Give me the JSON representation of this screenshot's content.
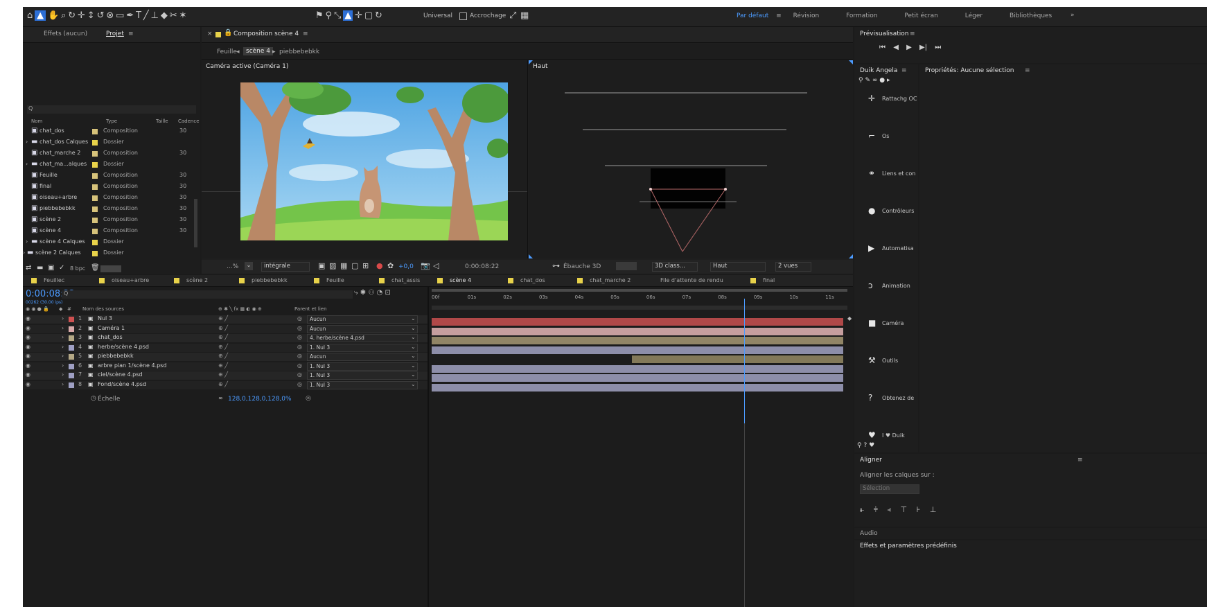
{
  "toolbar": {
    "universal_label": "Universal",
    "snap_label": "Accrochage",
    "workspaces": [
      "Par défaut",
      "Révision",
      "Formation",
      "Petit écran",
      "Léger",
      "Bibliothèques"
    ],
    "more": "»"
  },
  "project_panel": {
    "tabs": [
      "Effets (aucun)",
      "Projet"
    ],
    "search_placeholder": "Q",
    "columns": [
      "Nom",
      "Type",
      "Taille",
      "Cadence"
    ],
    "items": [
      {
        "name": "chat_dos",
        "type": "Composition",
        "extra": "30",
        "color": "#d6c27a",
        "kind": "comp"
      },
      {
        "name": "chat_dos Calques",
        "type": "Dossier",
        "extra": "",
        "color": "#e8d24a",
        "kind": "folder"
      },
      {
        "name": "chat_marche 2",
        "type": "Composition",
        "extra": "30",
        "color": "#d6c27a",
        "kind": "comp"
      },
      {
        "name": "chat_ma...alques",
        "type": "Dossier",
        "extra": "",
        "color": "#e8d24a",
        "kind": "folder"
      },
      {
        "name": "Feuille",
        "type": "Composition",
        "extra": "30",
        "color": "#d6c27a",
        "kind": "comp"
      },
      {
        "name": "final",
        "type": "Composition",
        "extra": "30",
        "color": "#d6c27a",
        "kind": "comp"
      },
      {
        "name": "oiseau+arbre",
        "type": "Composition",
        "extra": "30",
        "color": "#d6c27a",
        "kind": "comp"
      },
      {
        "name": "piebbebebkk",
        "type": "Composition",
        "extra": "30",
        "color": "#d6c27a",
        "kind": "comp"
      },
      {
        "name": "scène 2",
        "type": "Composition",
        "extra": "30",
        "color": "#d6c27a",
        "kind": "comp"
      },
      {
        "name": "scène 4",
        "type": "Composition",
        "extra": "30",
        "color": "#d6c27a",
        "kind": "comp"
      },
      {
        "name": "scène 4 Calques",
        "type": "Dossier",
        "extra": "",
        "color": "#e8d24a",
        "kind": "folder"
      },
      {
        "name": "scène 2 Calques",
        "type": "Dossier",
        "extra": "",
        "color": "#e8d24a",
        "kind": "folder"
      }
    ],
    "bpc": "8 bpc"
  },
  "comp_panel": {
    "title": "Composition scène 4",
    "breadcrumb": [
      "Feuille",
      "scène 4",
      "piebbebebkk"
    ],
    "active_view_label": "Caméra active (Caméra 1)",
    "top_view_label": "Haut",
    "zoom": "...%",
    "quality": "intégrale",
    "timecode": "0:00:08:22",
    "renderer": "Ébauche 3D",
    "view_mode": "3D class...",
    "view_select": "Haut",
    "views": "2 vues",
    "exposure": "+0,0"
  },
  "timeline": {
    "tabs": [
      "Feuillec",
      "oiseau+arbre",
      "scène 2",
      "piebbebebkk",
      "Feuille",
      "chat_assis",
      "scène 4",
      "chat_dos",
      "chat_marche 2",
      "File d'attente de rendu",
      "final"
    ],
    "active_tab_index": 6,
    "timecode": "0:00:08:22",
    "frames": "00262 (30.00 ips)",
    "search_placeholder": "Q",
    "col_source": "Nom des sources",
    "col_parent": "Parent et lien",
    "ruler": [
      "00f",
      "01s",
      "02s",
      "03s",
      "04s",
      "05s",
      "06s",
      "07s",
      "08s",
      "09s",
      "10s",
      "11s"
    ],
    "playhead_seconds": 8.73,
    "duration_seconds": 11.5,
    "layers": [
      {
        "num": "1",
        "name": "Nul 3",
        "parent": "Aucun",
        "color": "#cf5151",
        "bar": "#b04848",
        "start": 0,
        "end": 11.5
      },
      {
        "num": "2",
        "name": "Caméra 1",
        "parent": "Aucun",
        "color": "#d8a9a9",
        "bar": "#c69e9e",
        "start": 0,
        "end": 11.5
      },
      {
        "num": "3",
        "name": "chat_dos",
        "parent": "4. herbe/scène 4.psd",
        "color": "#b5a986",
        "bar": "#918566",
        "start": 0,
        "end": 11.5
      },
      {
        "num": "4",
        "name": "herbe/scène 4.psd",
        "parent": "1. Nul 3",
        "color": "#9fa0c4",
        "bar": "#8d8ea9",
        "start": 0,
        "end": 11.5
      },
      {
        "num": "5",
        "name": "piebbebebkk",
        "parent": "Aucun",
        "color": "#b5a986",
        "bar": "#837959",
        "start": 5.6,
        "end": 11.5
      },
      {
        "num": "6",
        "name": "arbre pian 1/scène 4.psd",
        "parent": "1. Nul 3",
        "color": "#9fa0c4",
        "bar": "#8d8ea9",
        "start": 0,
        "end": 11.5
      },
      {
        "num": "7",
        "name": "ciel/scène 4.psd",
        "parent": "1. Nul 3",
        "color": "#9fa0c4",
        "bar": "#8d8ea9",
        "start": 0,
        "end": 11.5
      },
      {
        "num": "8",
        "name": "Fond/scène 4.psd",
        "parent": "1. Nul 3",
        "color": "#9fa0c4",
        "bar": "#8d8ea9",
        "start": 0,
        "end": 11.5
      }
    ],
    "transform_label": "Échelle",
    "transform_value": "128,0,128,0,128,0%"
  },
  "preview": {
    "title": "Prévisualisation"
  },
  "duik": {
    "title": "Duik Angela",
    "items": [
      "Rattachg OC",
      "Os",
      "Liens et con",
      "Contrôleurs",
      "Automatisa",
      "Animation",
      "Caméra",
      "Outils",
      "Obtenez de",
      "I ♥ Duik"
    ]
  },
  "properties": {
    "title": "Propriétés: Aucune sélection"
  },
  "align": {
    "title": "Aligner",
    "label": "Aligner les calques sur :",
    "select": "Sélection"
  },
  "audio": {
    "title": "Audio"
  },
  "effects": {
    "title": "Effets et paramètres prédéfinis"
  }
}
